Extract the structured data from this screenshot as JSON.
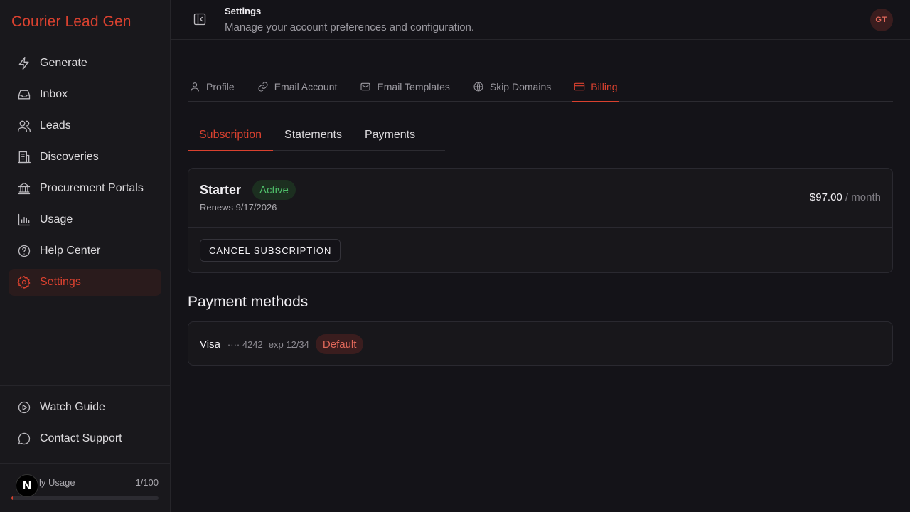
{
  "brand": "Courier Lead Gen",
  "sidebar": {
    "items": [
      {
        "label": "Generate",
        "icon": "lightning-icon"
      },
      {
        "label": "Inbox",
        "icon": "inbox-icon"
      },
      {
        "label": "Leads",
        "icon": "users-icon"
      },
      {
        "label": "Discoveries",
        "icon": "building-icon"
      },
      {
        "label": "Procurement Portals",
        "icon": "bank-icon"
      },
      {
        "label": "Usage",
        "icon": "bar-chart-icon"
      },
      {
        "label": "Help Center",
        "icon": "help-circle-icon"
      },
      {
        "label": "Settings",
        "icon": "gear-icon",
        "active": true
      }
    ],
    "bottom_items": [
      {
        "label": "Watch Guide",
        "icon": "play-circle-icon"
      },
      {
        "label": "Contact Support",
        "icon": "message-circle-icon"
      }
    ],
    "usage": {
      "label": "Monthly Usage",
      "visible_label": "ly Usage",
      "value": "1/100",
      "fraction": 0.01
    }
  },
  "header": {
    "title": "Settings",
    "subtitle": "Manage your account preferences and configuration.",
    "avatar_initials": "GT"
  },
  "tabs": [
    {
      "label": "Profile",
      "icon": "user-icon"
    },
    {
      "label": "Email Account",
      "icon": "link-icon"
    },
    {
      "label": "Email Templates",
      "icon": "mail-icon"
    },
    {
      "label": "Skip Domains",
      "icon": "globe-icon"
    },
    {
      "label": "Billing",
      "icon": "credit-card-icon",
      "active": true
    }
  ],
  "subtabs": [
    {
      "label": "Subscription",
      "active": true
    },
    {
      "label": "Statements"
    },
    {
      "label": "Payments"
    }
  ],
  "subscription": {
    "plan": "Starter",
    "status": "Active",
    "renews": "Renews 9/17/2026",
    "price": "$97.00",
    "period": "/ month",
    "cancel_label": "CANCEL SUBSCRIPTION"
  },
  "payment_methods": {
    "title": "Payment methods",
    "items": [
      {
        "brand": "Visa",
        "last4": "···· 4242",
        "exp": "exp 12/34",
        "badge": "Default"
      }
    ]
  },
  "colors": {
    "accent": "#d9412f",
    "background": "#141318",
    "active_green": "#4fbf6a"
  },
  "n_badge": "N"
}
